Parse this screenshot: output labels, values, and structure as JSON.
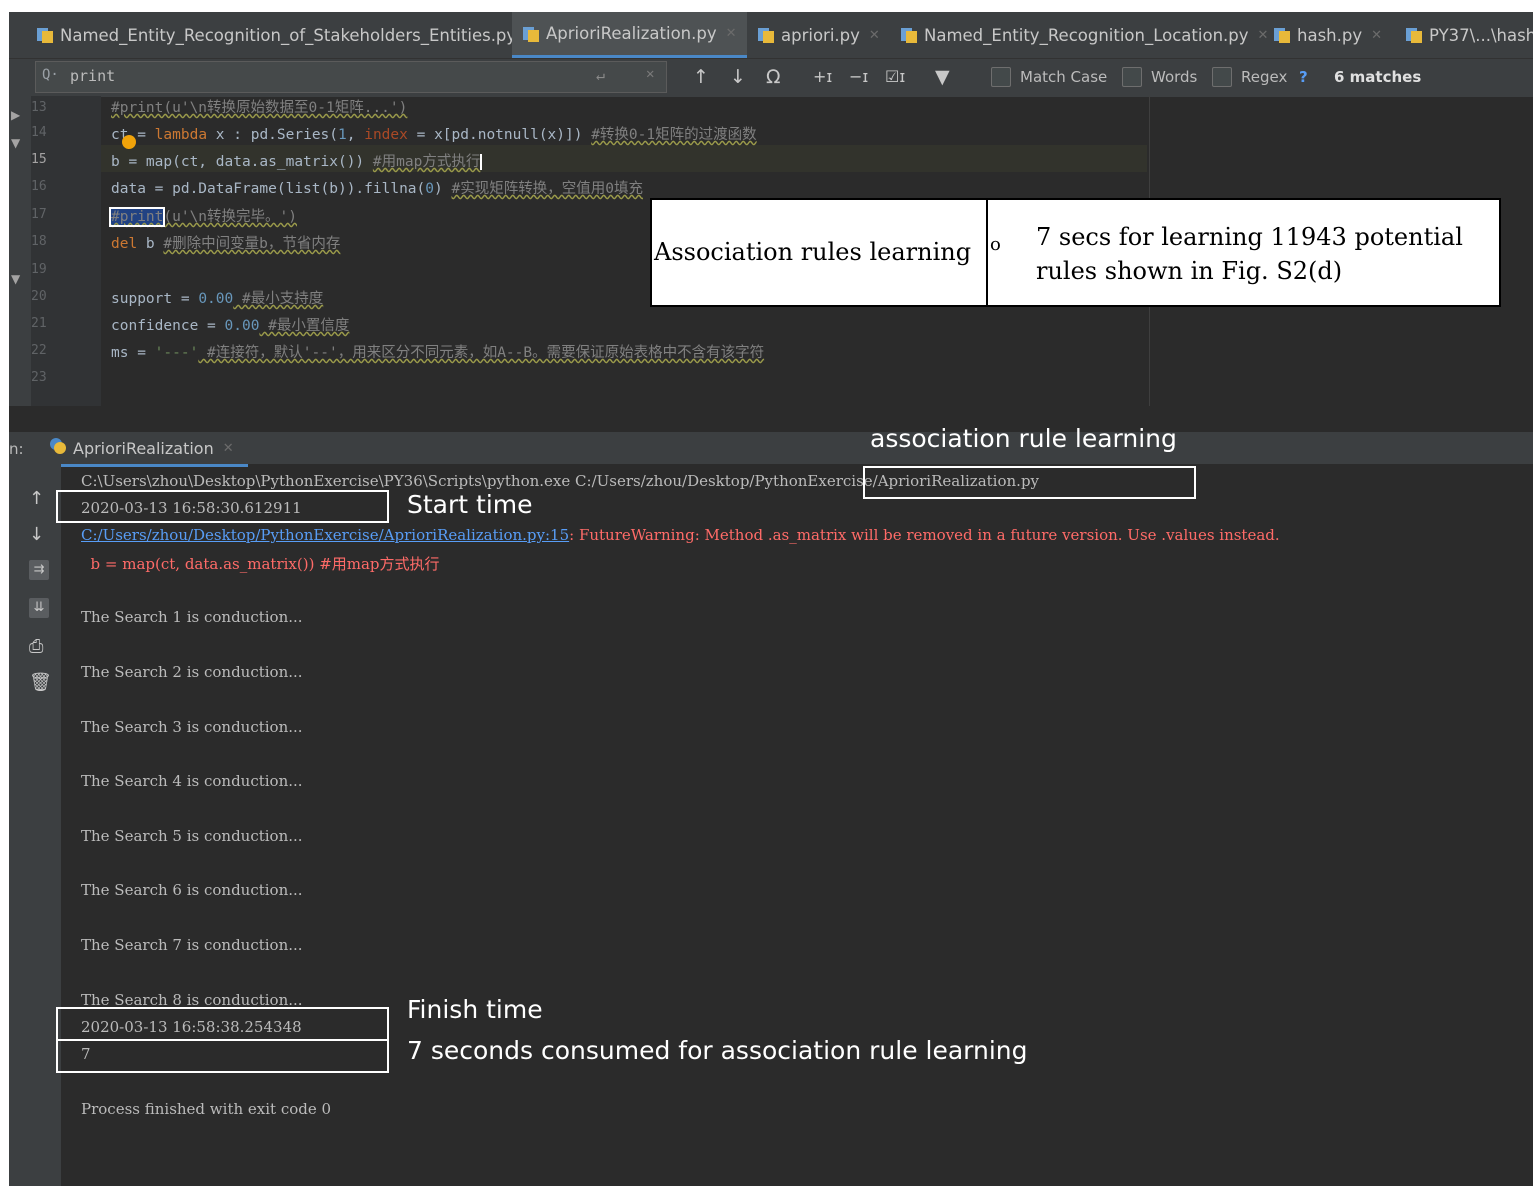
{
  "tabs": [
    {
      "label": "Named_Entity_Recognition_of_Stakeholders_Entities.py",
      "active": false
    },
    {
      "label": "AprioriRealization.py",
      "active": true
    },
    {
      "label": "apriori.py",
      "active": false
    },
    {
      "label": "Named_Entity_Recognition_Location.py",
      "active": false
    },
    {
      "label": "hash.py",
      "active": false
    },
    {
      "label": "PY37\\...\\hash.",
      "active": false
    }
  ],
  "find": {
    "query": "print",
    "match_case": "Match Case",
    "words": "Words",
    "regex": "Regex",
    "help": "?",
    "matches": "6 matches"
  },
  "editor": {
    "line_numbers": [
      "13",
      "14",
      "15",
      "16",
      "17",
      "18",
      "19",
      "20",
      "21",
      "22",
      "23"
    ],
    "lines": {
      "l13": "#print(u'\\n转换原始数据至0-1矩阵...')",
      "l14a": "ct",
      "l14b": " = ",
      "l14kw": "lambda",
      "l14c": " x : pd.Series(",
      "l14n": "1",
      "l14d": ", ",
      "l14p": "index",
      "l14e": " = x[pd.notnull(x)]) ",
      "l14cm": "#转换0-1矩阵的过渡函数",
      "l15a": "b = map(ct, data.as_matrix()) ",
      "l15cm": "#用map方式执行",
      "l16a": "data = pd.DataFrame(list(b)).fillna(",
      "l16n": "0",
      "l16b": ") ",
      "l16cm": "#实现矩阵转换，空值用0填充",
      "l17hl": "#print",
      "l17cm": "(u'\\n转换完毕。')",
      "l18kw": "del",
      "l18a": " b ",
      "l18cm": "#删除中间变量b，节省内存",
      "l20a": "support = ",
      "l20n": "0.00",
      "l20cm": " #最小支持度",
      "l21a": "confidence = ",
      "l21n": "0.00",
      "l21cm": " #最小置信度",
      "l22a": "ms = ",
      "l22s": "'---'",
      "l22cm": " #连接符，默认'--'，用来区分不同元素，如A--B。需要保证原始表格中不含有该字符"
    }
  },
  "run": {
    "label": "n:",
    "tab": "AprioriRealization",
    "lines": {
      "cmd": "C:\\Users\\zhou\\Desktop\\PythonExercise\\PY36\\Scripts\\python.exe C:/Users/zhou/Desktop/PythonExercise/AprioriRealization.py",
      "start": "2020-03-13 16:58:30.612911",
      "warn_link": "C:/Users/zhou/Desktop/PythonExercise/AprioriRealization.py:15",
      "warn_msg": ": FutureWarning: Method .as_matrix will be removed in a future version. Use .values instead.",
      "warn_code": "  b = map(ct, data.as_matrix()) #用map方式执行",
      "s1": "The Search 1 is conduction...",
      "s2": "The Search 2 is conduction...",
      "s3": "The Search 3 is conduction...",
      "s4": "The Search 4 is conduction...",
      "s5": "The Search 5 is conduction...",
      "s6": "The Search 6 is conduction...",
      "s7": "The Search 7 is conduction...",
      "s8": "The Search 8 is conduction...",
      "finish": "2020-03-13 16:58:38.254348",
      "secs": "7",
      "exit": "Process finished with exit code 0"
    }
  },
  "annotations": {
    "table_left": "Association rules learning",
    "table_bullet": "o",
    "table_right": "7 secs for learning 11943 potential rules shown in Fig. S2(d)",
    "assoc_label": "association rule learning",
    "start_label": "Start time",
    "finish_label": "Finish time",
    "consumed_label": "7 seconds consumed for association rule learning"
  },
  "colors": {
    "ide_bg": "#2b2b2b",
    "active_tab_accent": "#4a88c7",
    "warning": "#ff6b68",
    "link": "#589df6"
  }
}
